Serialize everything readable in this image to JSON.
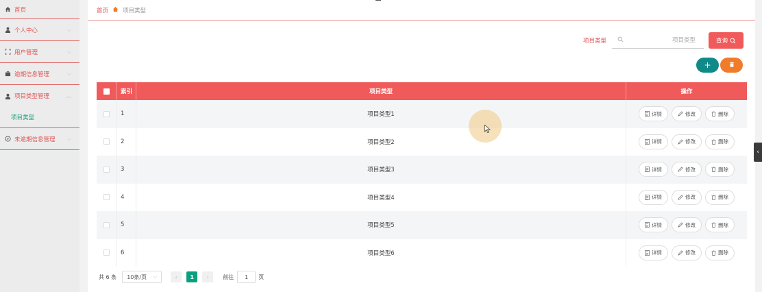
{
  "sidebar": {
    "items": [
      {
        "label": "首页",
        "icon": "home-icon",
        "has_chevron": false
      },
      {
        "label": "个人中心",
        "icon": "user-icon",
        "has_chevron": true
      },
      {
        "label": "用户管理",
        "icon": "frame-icon",
        "has_chevron": true
      },
      {
        "label": "逾期信息管理",
        "icon": "briefcase-icon",
        "has_chevron": true
      },
      {
        "label": "项目类型管理",
        "icon": "user-icon",
        "has_chevron": true,
        "expanded": true
      },
      {
        "label": "未逾期信息管理",
        "icon": "compass-icon",
        "has_chevron": true
      }
    ],
    "sub_item": {
      "label": "项目类型"
    }
  },
  "breadcrumb": {
    "home": "首页",
    "current": "项目类型"
  },
  "search": {
    "label": "项目类型",
    "placeholder": "项目类型",
    "query_button": "查询"
  },
  "colors": {
    "accent": "#f05a5a",
    "teal": "#0f8a88",
    "orange": "#f07b2a",
    "green": "#0aa07e"
  },
  "table": {
    "headers": {
      "index": "索引",
      "name": "项目类型",
      "ops": "操作"
    },
    "rows": [
      {
        "index": "1",
        "name": "项目类型1"
      },
      {
        "index": "2",
        "name": "项目类型2"
      },
      {
        "index": "3",
        "name": "项目类型3"
      },
      {
        "index": "4",
        "name": "项目类型4"
      },
      {
        "index": "5",
        "name": "项目类型5"
      },
      {
        "index": "6",
        "name": "项目类型6"
      }
    ],
    "ops": {
      "detail": "详情",
      "edit": "修改",
      "delete": "删除"
    }
  },
  "pagination": {
    "total": "共 6 条",
    "page_size": "10条/页",
    "current_page": "1",
    "goto_label": "前往",
    "goto_value": "1",
    "page_suffix": "页"
  }
}
